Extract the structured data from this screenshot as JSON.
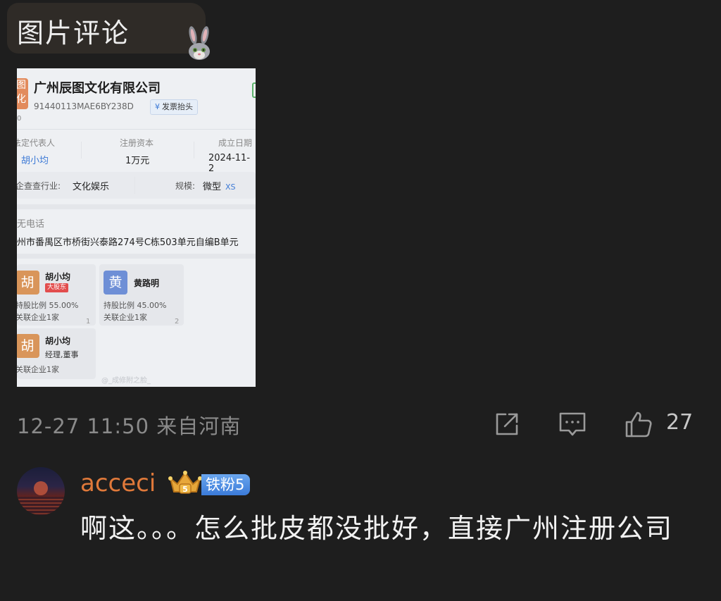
{
  "header": {
    "title": "图片评论",
    "sticker_icon": "bunny-sticker-icon"
  },
  "screenshot": {
    "logo_text": "图\n化",
    "logo_sub": "0",
    "company_name": "广州辰图文化有限公司",
    "credit_code": "91440113MAE6BY238D",
    "invoice_badge_icon": "¥",
    "invoice_badge_label": "发票抬头",
    "legal_rep_label": "法定代表人",
    "legal_rep_value": "胡小均",
    "capital_label": "注册资本",
    "capital_value": "1万元",
    "founded_label": "成立日期",
    "founded_value": "2024-11-2",
    "industry_label": "企查查行业:",
    "industry_value": "文化娱乐",
    "scale_label": "规模:",
    "scale_value": "微型",
    "scale_badge": "XS",
    "phone_text": "无电话",
    "address_text": "州市番禺区市桥街兴泰路274号C栋503单元自编B单元",
    "shareholders": [
      {
        "avatar": "胡",
        "name": "胡小均",
        "tag": "大股东",
        "ratio": "持股比例 55.00%",
        "related": "关联企业1家",
        "index": "1"
      },
      {
        "avatar": "黄",
        "name": "黄路明",
        "tag": "",
        "ratio": "持股比例 45.00%",
        "related": "关联企业1家",
        "index": "2"
      }
    ],
    "staff": [
      {
        "avatar": "胡",
        "name": "胡小均",
        "role": "经理,董事",
        "related": "关联企业1家"
      }
    ],
    "watermark": "@_成修附之脸_",
    "colors": {
      "accent_blue": "#3d7ad6",
      "avatar_orange": "#d9955a",
      "avatar_blue": "#6e8fd6"
    }
  },
  "post_meta": {
    "timestamp": "12-27 11:50",
    "location": "来自河南",
    "share_icon": "share-icon",
    "comment_icon": "comment-icon",
    "like_icon": "thumbs-up-icon",
    "like_count": "27"
  },
  "comment": {
    "username": "acceci",
    "crown_icon": "crown-badge-icon",
    "fan_badge": "铁粉5",
    "text": "啊这。。。怎么批皮都没批好，直接广州注册公司"
  },
  "colors": {
    "background": "#1e1e1e",
    "username": "#e0793a",
    "fan_badge": "#3b7bd9"
  }
}
